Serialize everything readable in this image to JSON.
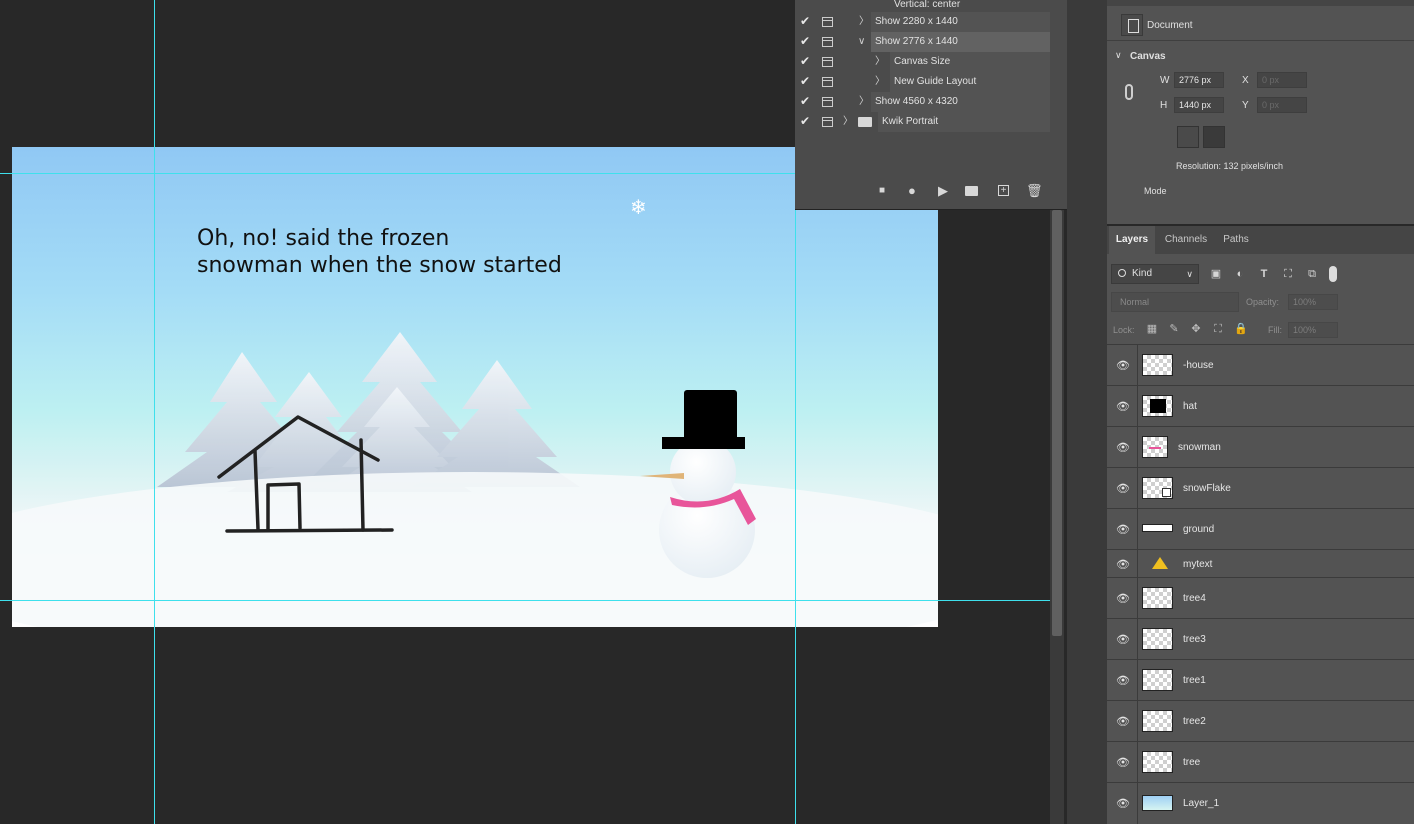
{
  "canvas": {
    "text_line1": "Oh, no! said the frozen",
    "text_line2": "snowman when the snow started"
  },
  "actions": {
    "rows": [
      {
        "label": "Vertical: center",
        "checked": false
      },
      {
        "label": "Show 2280 x 1440",
        "checked": true
      },
      {
        "label": "Show 2776 x 1440",
        "checked": true,
        "selected": true,
        "expanded": true
      },
      {
        "label": "Canvas Size",
        "checked": true
      },
      {
        "label": "New Guide Layout",
        "checked": true
      },
      {
        "label": "Show 4560 x 4320",
        "checked": true
      },
      {
        "label": "Kwik Portrait",
        "checked": true,
        "folder": true
      }
    ]
  },
  "properties": {
    "doc_label": "Document",
    "section_title": "Canvas",
    "w_label": "W",
    "w_value": "2776 px",
    "h_label": "H",
    "h_value": "1440 px",
    "x_label": "X",
    "x_placeholder": "0 px",
    "y_label": "Y",
    "y_placeholder": "0 px",
    "resolution": "Resolution: 132 pixels/inch",
    "mode_label": "Mode"
  },
  "layers_panel": {
    "tabs": [
      "Layers",
      "Channels",
      "Paths"
    ],
    "active_tab": "Layers",
    "kind_filter": "Kind",
    "blend_mode": "Normal",
    "opacity_label": "Opacity:",
    "opacity_value": "100%",
    "lock_label": "Lock:",
    "fill_label": "Fill:",
    "fill_value": "100%",
    "layers": [
      {
        "name": "-house",
        "thumb": "checker"
      },
      {
        "name": "hat",
        "thumb": "hat"
      },
      {
        "name": "snowman",
        "thumb": "snowman"
      },
      {
        "name": "snowFlake",
        "thumb": "smart-object"
      },
      {
        "name": "ground",
        "thumb": "ground"
      },
      {
        "name": "mytext",
        "thumb": "warning-text"
      },
      {
        "name": "tree4",
        "thumb": "tree"
      },
      {
        "name": "tree3",
        "thumb": "tree"
      },
      {
        "name": "tree1",
        "thumb": "tree"
      },
      {
        "name": "tree2",
        "thumb": "tree"
      },
      {
        "name": "tree",
        "thumb": "tree"
      },
      {
        "name": "Layer_1",
        "thumb": "sky"
      }
    ]
  },
  "colors": {
    "sky_top": "#90c8f4",
    "guide": "#3ee0ec",
    "scarf": "#e8559a"
  }
}
